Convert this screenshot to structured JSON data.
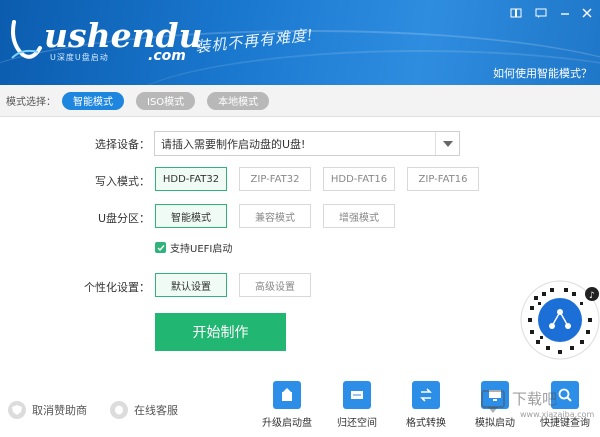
{
  "header": {
    "logo_text": "ushendu",
    "logo_com": ".com",
    "logo_sub": "U深度U盘启动",
    "slogan": "装机不再有难度!",
    "help_link": "如何使用智能模式？"
  },
  "modebar": {
    "label": "模式选择：",
    "modes": [
      "智能模式",
      "ISO模式",
      "本地模式"
    ],
    "active": "智能模式"
  },
  "form": {
    "device_label": "选择设备：",
    "device_placeholder": "请插入需要制作启动盘的U盘!",
    "write_mode_label": "写入模式：",
    "write_modes": [
      "HDD-FAT32",
      "ZIP-FAT32",
      "HDD-FAT16",
      "ZIP-FAT16"
    ],
    "write_mode_selected": "HDD-FAT32",
    "partition_label": "U盘分区：",
    "partitions": [
      "智能模式",
      "兼容模式",
      "增强模式"
    ],
    "partition_selected": "智能模式",
    "uefi_label": "支持UEFI启动",
    "uefi_checked": true,
    "personal_label": "个性化设置：",
    "personal_options": [
      "默认设置",
      "高级设置"
    ],
    "personal_selected": "默认设置",
    "start_button": "开始制作"
  },
  "footer": {
    "links": [
      "取消赞助商",
      "在线客服"
    ],
    "tools": [
      "升级启动盘",
      "归还空间",
      "格式转换",
      "模拟启动",
      "快捷键查询"
    ]
  },
  "watermark": {
    "text": "下载吧",
    "url": "www.xiazaiba.com"
  },
  "colors": {
    "header_blue": "#1a78cf",
    "accent_blue": "#1f86e0",
    "accent_green": "#22b673",
    "inactive_grey": "#b8b8b8"
  }
}
